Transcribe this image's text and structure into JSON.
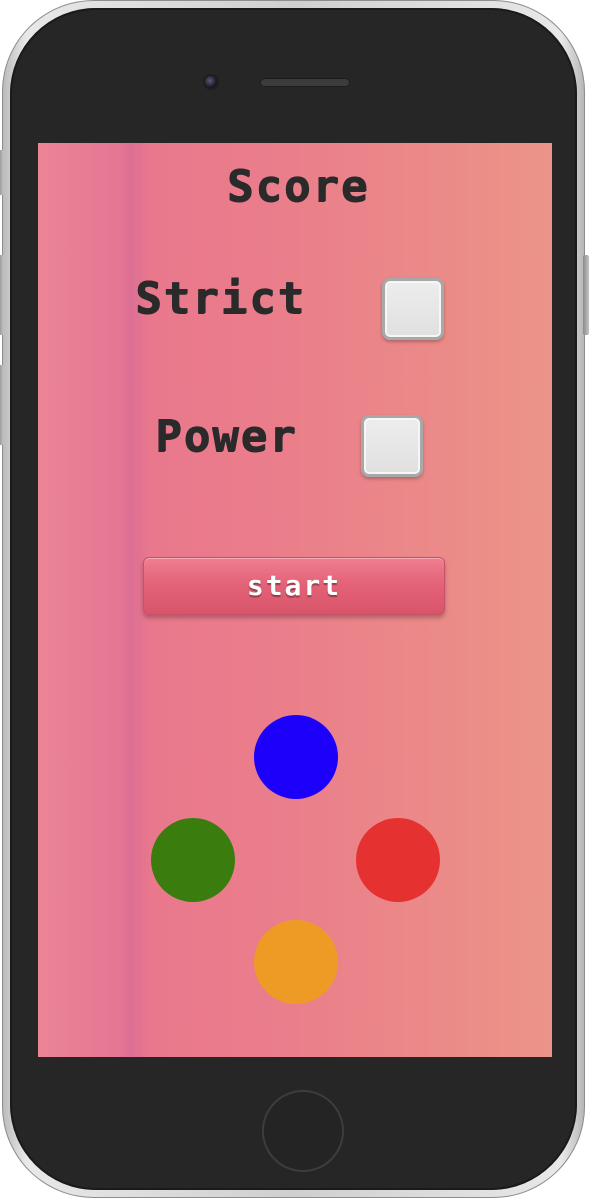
{
  "game": {
    "score_label": "Score",
    "strict_label": "Strict",
    "power_label": "Power",
    "start_label": "start",
    "strict_checked": false,
    "power_checked": false
  },
  "pads": {
    "blue": "#1d00fa",
    "green": "#3a7c0d",
    "red": "#e63131",
    "yellow": "#ee9b26"
  },
  "device": {
    "body_color": "#262626",
    "frame_color": "#cfcfcf"
  }
}
